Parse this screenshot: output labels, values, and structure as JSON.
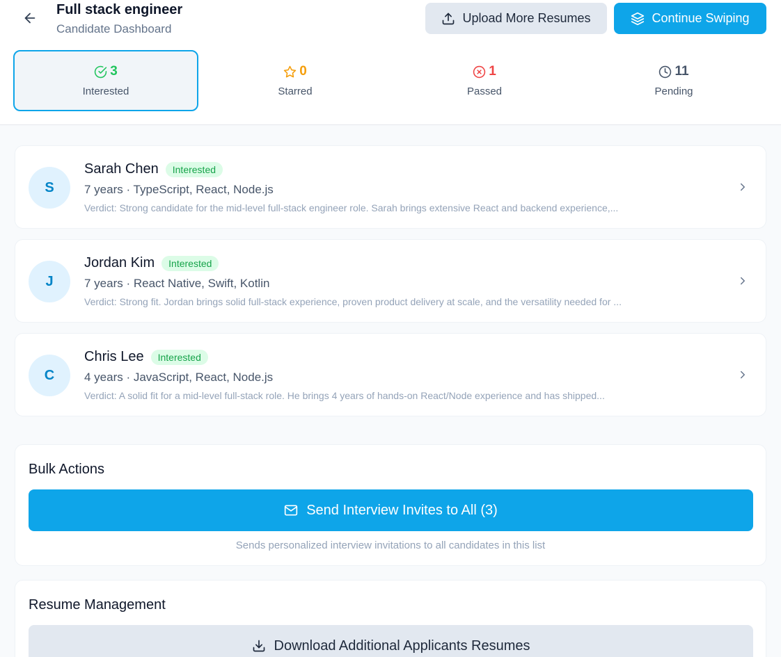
{
  "header": {
    "title": "Full stack engineer",
    "subtitle": "Candidate Dashboard",
    "upload_label": "Upload More Resumes",
    "swipe_label": "Continue Swiping"
  },
  "stats": [
    {
      "value": "3",
      "label": "Interested",
      "color": "#22c55e",
      "icon": "check-circle-icon",
      "active": true
    },
    {
      "value": "0",
      "label": "Starred",
      "color": "#f59e0b",
      "icon": "star-icon",
      "active": false
    },
    {
      "value": "1",
      "label": "Passed",
      "color": "#ef4444",
      "icon": "x-circle-icon",
      "active": false
    },
    {
      "value": "11",
      "label": "Pending",
      "color": "#475569",
      "icon": "clock-icon",
      "active": false
    }
  ],
  "candidates": [
    {
      "initial": "S",
      "name": "Sarah Chen",
      "status": "Interested",
      "meta": "7 years · TypeScript, React, Node.js",
      "verdict": "Verdict: Strong candidate for the mid-level full-stack engineer role. Sarah brings extensive React and backend experience,..."
    },
    {
      "initial": "J",
      "name": "Jordan Kim",
      "status": "Interested",
      "meta": "7 years · React Native, Swift, Kotlin",
      "verdict": "Verdict: Strong fit. Jordan brings solid full-stack experience, proven product delivery at scale, and the versatility needed for ..."
    },
    {
      "initial": "C",
      "name": "Chris Lee",
      "status": "Interested",
      "meta": "4 years · JavaScript, React, Node.js",
      "verdict": "Verdict: A solid fit for a mid-level full-stack role. He brings 4 years of hands-on React/Node experience and has shipped..."
    }
  ],
  "bulk": {
    "title": "Bulk Actions",
    "invite_label": "Send Interview Invites to All (3)",
    "hint": "Sends personalized interview invitations to all candidates in this list"
  },
  "resume": {
    "title": "Resume Management",
    "download_label": "Download Additional Applicants Resumes"
  },
  "colors": {
    "accent": "#0ea5e9",
    "interested_badge_bg": "#dcfce7",
    "interested_badge_text": "#16a34a"
  }
}
